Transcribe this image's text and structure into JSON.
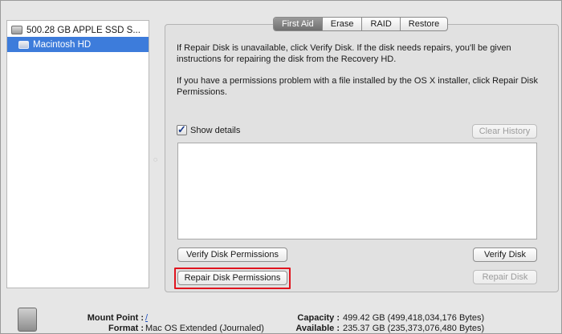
{
  "sidebar": {
    "disk_label": "500.28 GB APPLE SSD S...",
    "volume_label": "Macintosh HD"
  },
  "tabs": [
    "First Aid",
    "Erase",
    "RAID",
    "Restore"
  ],
  "active_tab": "First Aid",
  "first_aid": {
    "paragraph1": "If Repair Disk is unavailable, click Verify Disk. If the disk needs repairs, you'll be given instructions for repairing the disk from the Recovery HD.",
    "paragraph2": "If you have a permissions problem with a file installed by the OS X installer, click Repair Disk Permissions.",
    "show_details_label": "Show details",
    "show_details_checked": true,
    "clear_history_label": "Clear History",
    "verify_permissions_label": "Verify Disk Permissions",
    "repair_permissions_label": "Repair Disk Permissions",
    "verify_disk_label": "Verify Disk",
    "repair_disk_label": "Repair Disk"
  },
  "info": {
    "mount_point_label": "Mount Point :",
    "mount_point_value": "/",
    "format_label": "Format :",
    "format_value": "Mac OS Extended (Journaled)",
    "capacity_label": "Capacity :",
    "capacity_value": "499.42 GB (499,418,034,176 Bytes)",
    "available_label": "Available :",
    "available_value": "235.37 GB (235,373,076,480 Bytes)"
  },
  "colors": {
    "selection": "#3d7cdb",
    "highlight_border": "#e0141e",
    "panel": "#e1e1e1"
  },
  "icons": [
    "drive-icon",
    "volume-icon",
    "checkmark-icon",
    "splitter-handle-icon",
    "bottom-drive-icon"
  ]
}
